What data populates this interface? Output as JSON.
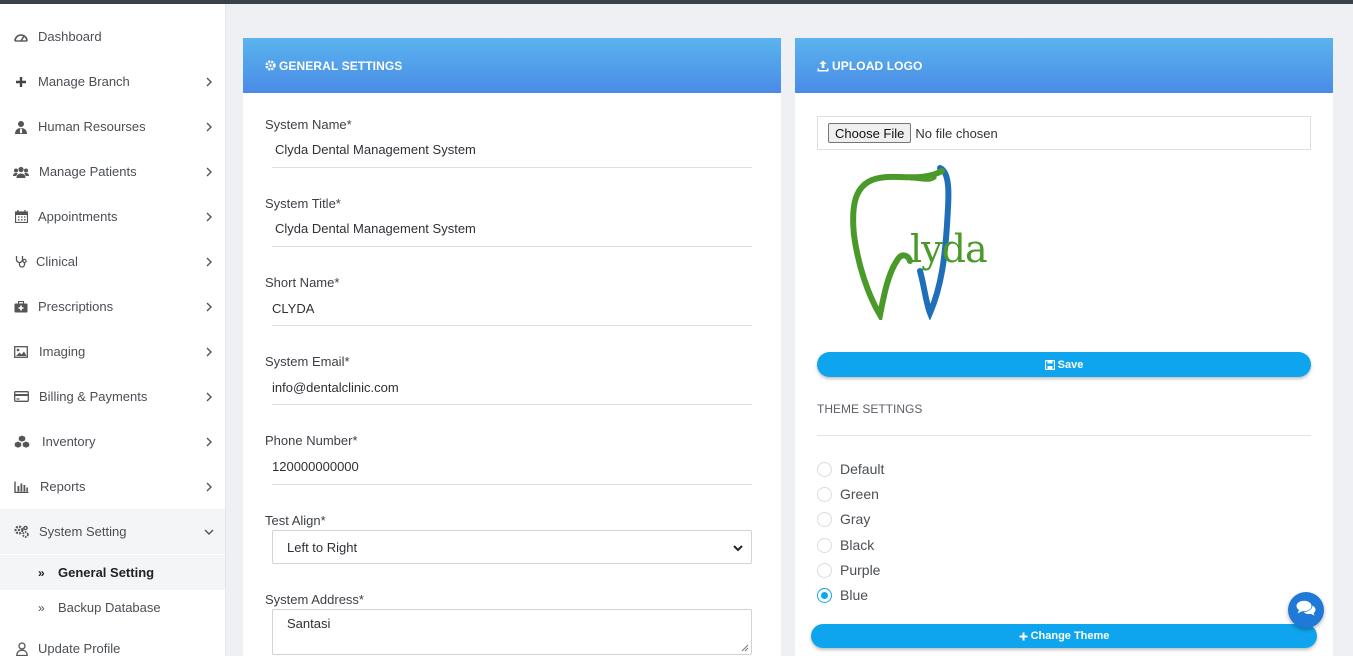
{
  "sidebar": {
    "items": [
      {
        "label": "Dashboard",
        "icon": "dashboard-icon"
      },
      {
        "label": "Manage Branch",
        "icon": "plus-icon"
      },
      {
        "label": "Human Resourses",
        "icon": "user-tie-icon"
      },
      {
        "label": "Manage Patients",
        "icon": "users-icon"
      },
      {
        "label": "Appointments",
        "icon": "calendar-icon"
      },
      {
        "label": "Clinical",
        "icon": "stethoscope-icon"
      },
      {
        "label": "Prescriptions",
        "icon": "medkit-icon"
      },
      {
        "label": "Imaging",
        "icon": "image-icon"
      },
      {
        "label": "Billing & Payments",
        "icon": "credit-card-icon"
      },
      {
        "label": "Inventory",
        "icon": "cubes-icon"
      },
      {
        "label": "Reports",
        "icon": "bar-chart-icon"
      },
      {
        "label": "System Setting",
        "icon": "gears-icon"
      }
    ],
    "subitems": [
      {
        "label": "General Setting",
        "arrow": "»"
      },
      {
        "label": "Backup Database",
        "arrow": "»"
      }
    ],
    "bottom_item": {
      "label": "Update Profile",
      "icon": "user-icon"
    }
  },
  "general_settings": {
    "title": "GENERAL SETTINGS",
    "system_name_label": "System Name*",
    "system_name_value": "Clyda Dental Management System",
    "system_title_label": "System Title*",
    "system_title_value": "Clyda Dental Management System",
    "short_name_label": "Short Name*",
    "short_name_value": "CLYDA",
    "system_email_label": "System Email*",
    "system_email_value": "info@dentalclinic.com",
    "phone_label": "Phone Number*",
    "phone_value": "120000000000",
    "text_align_label": "Test Align*",
    "text_align_value": "Left to Right",
    "address_label": "System Address*",
    "address_value": "Santasi"
  },
  "upload_logo": {
    "title": "UPLOAD LOGO",
    "choose_file_label": "Choose File",
    "file_status": "No file chosen",
    "logo_text": "lyda",
    "save_label": "Save"
  },
  "theme": {
    "title": "THEME SETTINGS",
    "options": [
      "Default",
      "Green",
      "Gray",
      "Black",
      "Purple",
      "Blue"
    ],
    "selected": "Blue",
    "change_label": "Change Theme"
  },
  "colors": {
    "accent": "#0ea5ee",
    "header_gradient_top": "#5ab4ee",
    "header_gradient_bottom": "#4a8be6",
    "logo_green": "#4a9a2a",
    "logo_blue": "#1f6fb8"
  }
}
